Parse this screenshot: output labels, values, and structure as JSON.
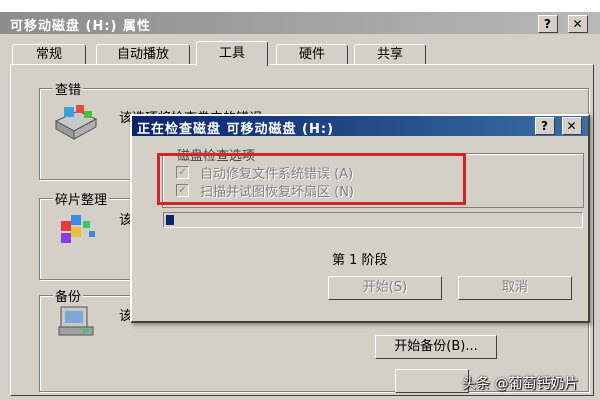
{
  "window": {
    "title": "可移动磁盘 (H:) 属性",
    "help_btn": "?",
    "close_btn": "✕"
  },
  "tabs": [
    {
      "label": "常规"
    },
    {
      "label": "自动播放"
    },
    {
      "label": "工具"
    },
    {
      "label": "硬件"
    },
    {
      "label": "共享"
    }
  ],
  "sections": {
    "error_check": {
      "title": "查错",
      "desc": "该选项将检查卷中的错误。"
    },
    "defrag": {
      "title": "碎片整理",
      "desc_partial": "该"
    },
    "backup": {
      "title": "备份",
      "desc_partial": "该"
    },
    "bottom_button": "开始备份(B)..."
  },
  "dialog": {
    "title": "正在检查磁盘 可移动磁盘 (H:)",
    "help_btn": "?",
    "close_btn": "✕",
    "options_title": "磁盘检查选项",
    "option1": "自动修复文件系统错误 (A)",
    "option2": "扫描并试图恢复坏扇区 (N)",
    "progress_fraction": 0.02,
    "stage": "第 1 阶段",
    "start_button": "开始(S)",
    "cancel_button": "取消"
  },
  "watermark": "头条 @葡萄钙奶片",
  "colors": {
    "dialog_title_start": "#0a246a",
    "dialog_title_end": "#3a6ea5",
    "highlight_box": "#d4242a",
    "face": "#d4d0c8"
  }
}
